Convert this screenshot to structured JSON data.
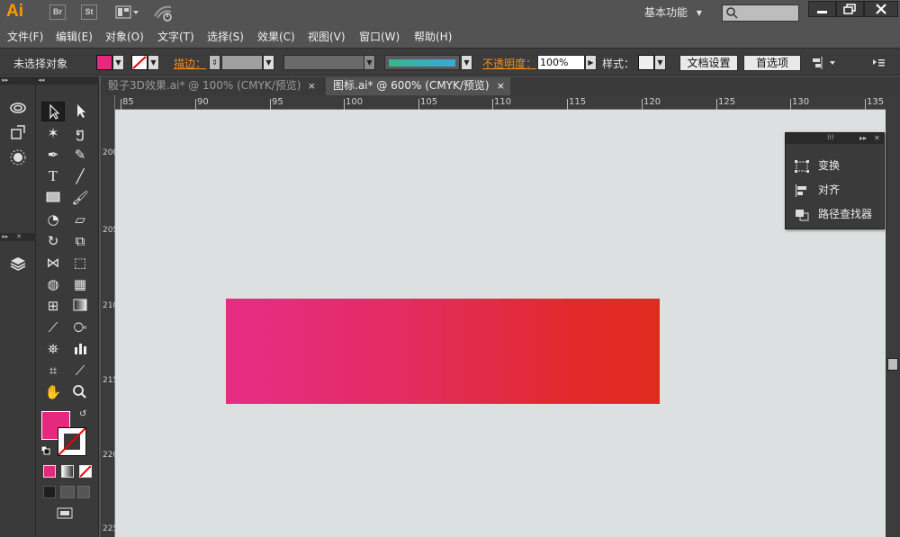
{
  "app": {
    "logo": "Ai",
    "bridge_btn": "Br",
    "stock_btn": "St",
    "workspace": "基本功能",
    "workspace_arrow": "▾"
  },
  "menu": [
    "文件(F)",
    "编辑(E)",
    "对象(O)",
    "文字(T)",
    "选择(S)",
    "效果(C)",
    "视图(V)",
    "窗口(W)",
    "帮助(H)"
  ],
  "control": {
    "selection": "未选择对象",
    "stroke_label": "描边：",
    "opacity_label": "不透明度：",
    "opacity_value": "100%",
    "style_label": "样式：",
    "doc_setup": "文档设置",
    "preferences": "首选项",
    "fill_color": "#e6297f"
  },
  "tabs": [
    {
      "label": "骰子3D效果.ai* @ 100% (CMYK/预览)",
      "close": "×",
      "active": false
    },
    {
      "label": "图标.ai* @ 600% (CMYK/预览)",
      "close": "×",
      "active": true
    }
  ],
  "ruler": {
    "h": [
      "85",
      "90",
      "95",
      "100",
      "105",
      "110",
      "115",
      "120",
      "125",
      "130",
      "135"
    ],
    "v": [
      "200",
      "205",
      "210",
      "215",
      "220",
      "225"
    ]
  },
  "float_panel": {
    "items": [
      "变换",
      "对齐",
      "路径查找器"
    ]
  },
  "canvas": {
    "gradient_start": "#e62d86",
    "gradient_end": "#e02b1e"
  }
}
